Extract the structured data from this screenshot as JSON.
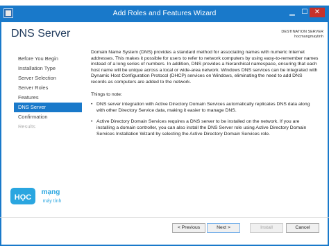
{
  "window": {
    "title": "Add Roles and Features Wizard",
    "controls": {
      "minimize": "▁",
      "maximize": "☐",
      "close": "✕"
    }
  },
  "page": {
    "title": "DNS Server",
    "destination_label": "DESTINATION SERVER",
    "destination_name": "hocmangmaytinh"
  },
  "nav": {
    "items": [
      {
        "label": "Before You Begin",
        "state": "normal"
      },
      {
        "label": "Installation Type",
        "state": "normal"
      },
      {
        "label": "Server Selection",
        "state": "normal"
      },
      {
        "label": "Server Roles",
        "state": "normal"
      },
      {
        "label": "Features",
        "state": "normal"
      },
      {
        "label": "DNS Server",
        "state": "active"
      },
      {
        "label": "Confirmation",
        "state": "normal"
      },
      {
        "label": "Results",
        "state": "disabled"
      }
    ]
  },
  "content": {
    "intro": "Domain Name System (DNS) provides a standard method for associating names with numeric Internet addresses. This makes it possible for users to refer to network computers by using easy-to-remember names instead of a long series of numbers. In addition, DNS provides a hierarchical namespace, ensuring that each host name will be unique across a local or wide-area network. Windows DNS services can be integrated with Dynamic Host Configuration Protocol (DHCP) services on Windows, eliminating the need to add DNS records as computers are added to the network.",
    "things_to_note": "Things to note:",
    "bullets": [
      "DNS server integration with Active Directory Domain Services automatically replicates DNS data along with other Directory Service data, making it easier to manage DNS.",
      "Active Directory Domain Services requires a DNS server to be installed on the network. If you are installing a domain controller, you can also install the DNS Server role using Active Directory Domain Services Installation Wizard by selecting the Active Directory Domain Services role."
    ]
  },
  "logo": {
    "main": "HỌC",
    "sub1": "mạng",
    "sub2": "máy tính"
  },
  "buttons": {
    "previous": "< Previous",
    "next": "Next >",
    "install": "Install",
    "cancel": "Cancel"
  },
  "colors": {
    "accent": "#1979ca",
    "logo_bg": "#2aa6e0"
  }
}
